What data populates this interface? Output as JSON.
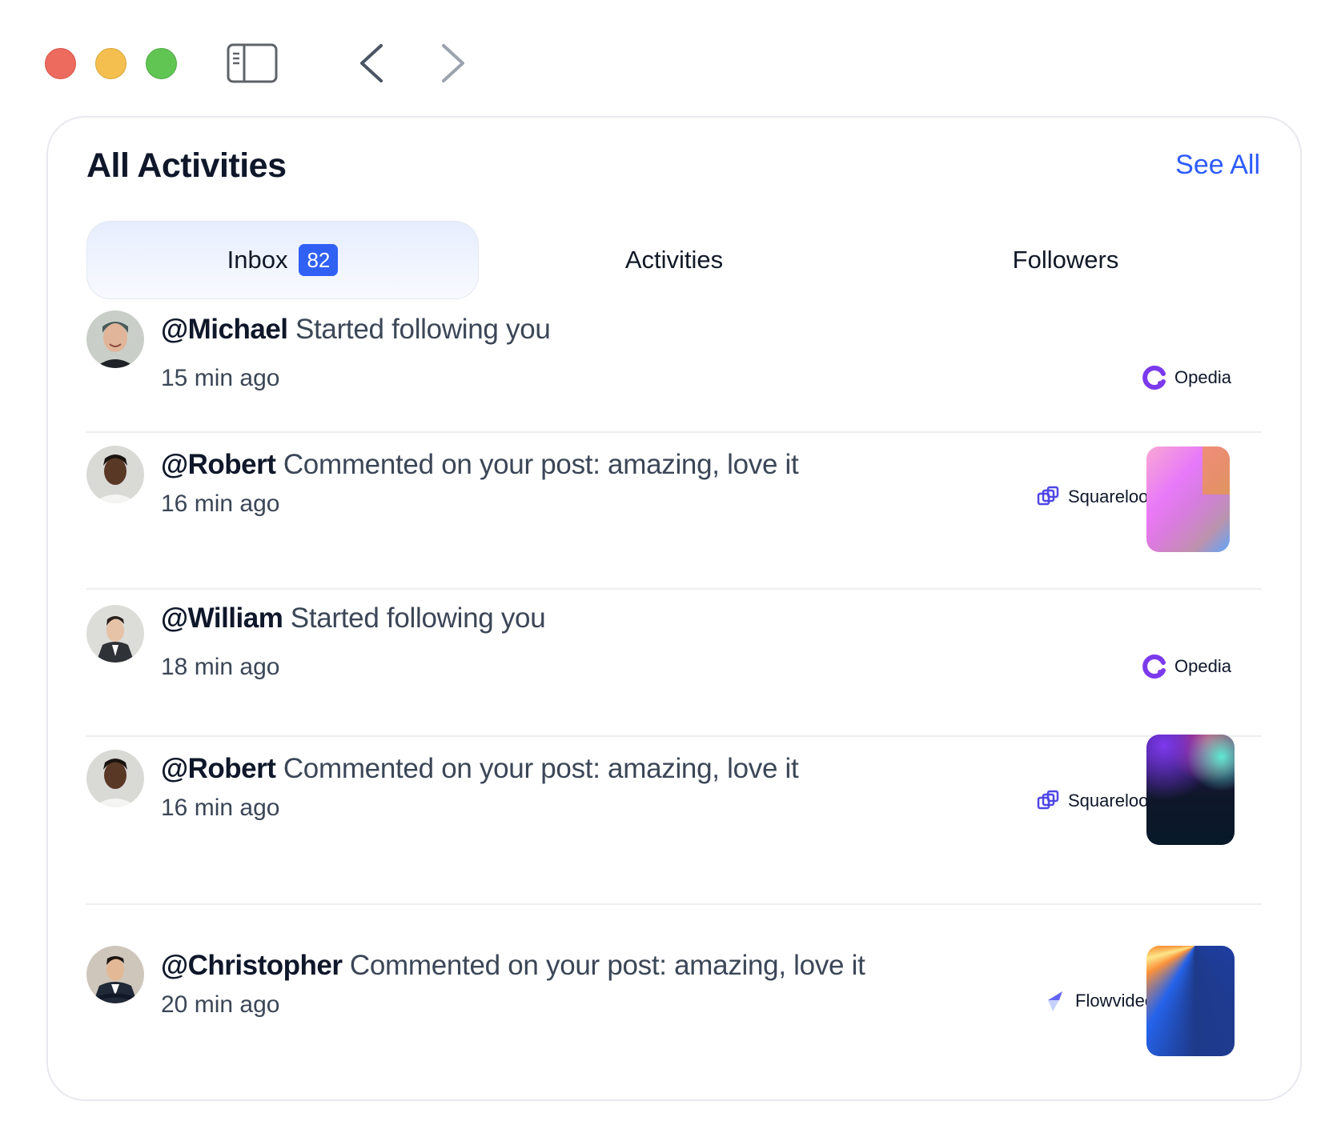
{
  "window": {
    "sidebar_toggle_icon": "sidebar-toggle-icon",
    "back_icon": "chevron-left-icon",
    "forward_icon": "chevron-right-icon"
  },
  "header": {
    "title": "All Activities",
    "see_all": "See All"
  },
  "tabs": [
    {
      "label": "Inbox",
      "badge": "82",
      "active": true
    },
    {
      "label": "Activities",
      "active": false
    },
    {
      "label": "Followers",
      "active": false
    }
  ],
  "activities": [
    {
      "handle": "@Michael",
      "text": " Started following you",
      "time": "15 min ago",
      "brand": "Opedia",
      "brand_icon": "opedia-logo-icon",
      "thumbnail": null
    },
    {
      "handle": "@Robert",
      "text": " Commented on your post:  amazing, love it",
      "time": "16 min ago",
      "brand": "Squareloop",
      "brand_icon": "squareloop-logo-icon",
      "thumbnail": "pink-orange-blue-gradient"
    },
    {
      "handle": "@William",
      "text": " Started following you",
      "time": "18 min ago",
      "brand": "Opedia",
      "brand_icon": "opedia-logo-icon",
      "thumbnail": null
    },
    {
      "handle": "@Robert",
      "text": " Commented on your post:  amazing, love it",
      "time": "16 min ago",
      "brand": "Squareloop",
      "brand_icon": "squareloop-logo-icon",
      "thumbnail": "dark-aurora-gradient"
    },
    {
      "handle": "@Christopher",
      "text": " Commented on your post:  amazing, love it",
      "time": "20 min ago",
      "brand": "Flowvideo",
      "brand_icon": "flowvideo-logo-icon",
      "thumbnail": "blue-orange-rays"
    }
  ],
  "colors": {
    "accent": "#2d5bff",
    "badge": "#3160f5",
    "opedia": "#7c3aed",
    "squareloop": "#4f46e5",
    "flowvideo": "#5b5bf5"
  }
}
